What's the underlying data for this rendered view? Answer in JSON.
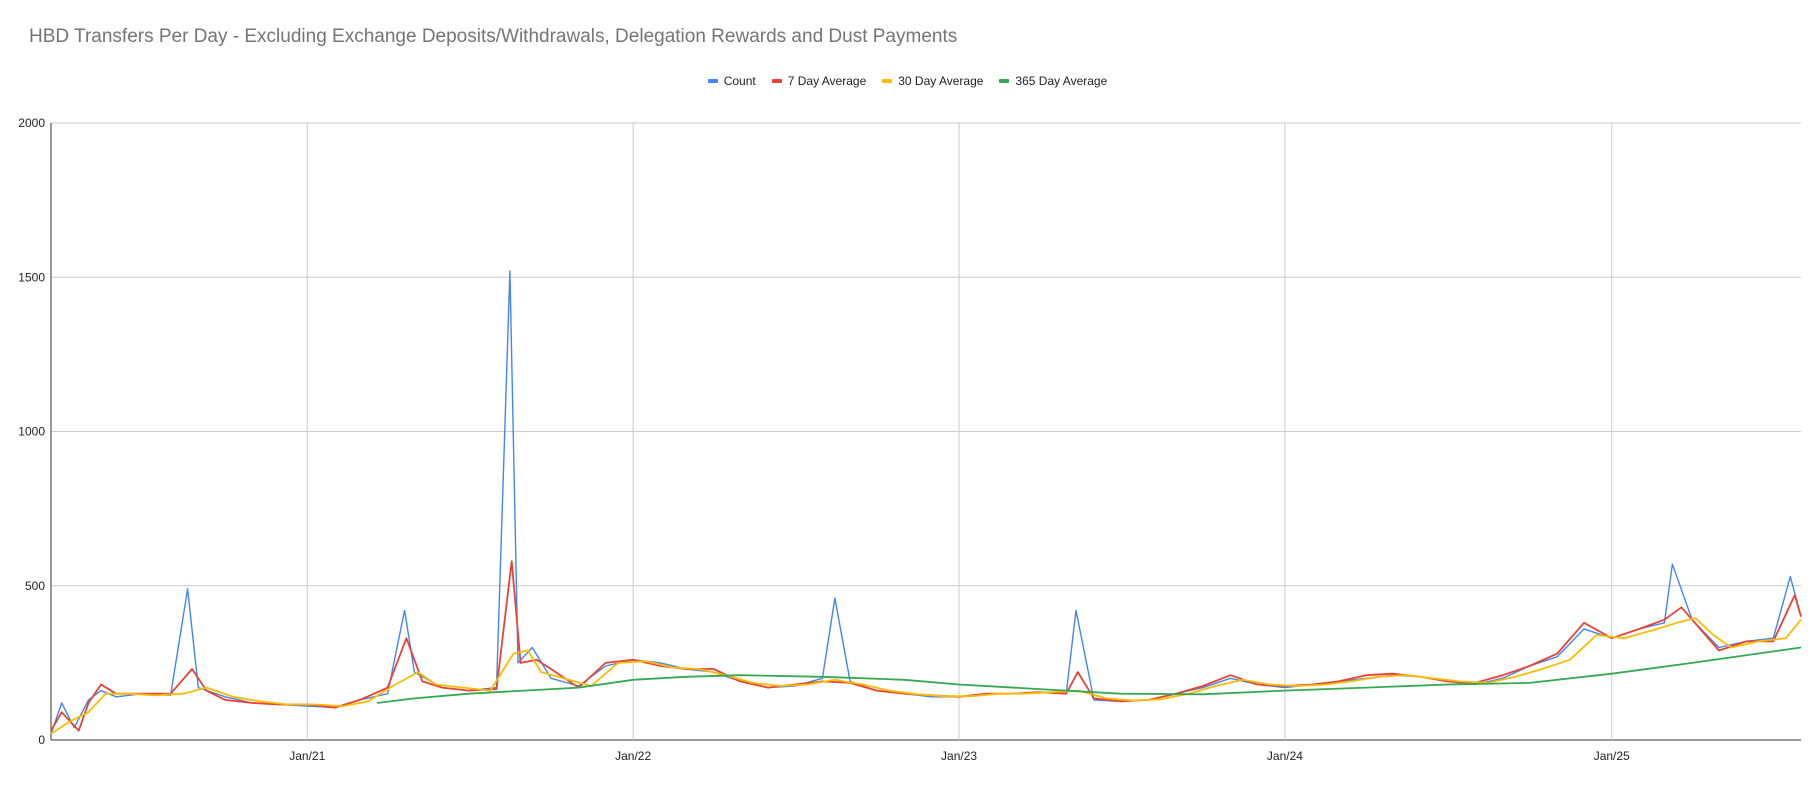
{
  "chart_data": {
    "type": "line",
    "title": "HBD Transfers Per Day - Excluding Exchange Deposits/Withdrawals, Delegation Rewards and Dust Payments",
    "xlabel": "",
    "ylabel": "",
    "x_range": [
      "2020-03-20",
      "2025-08-01"
    ],
    "ylim": [
      0,
      2000
    ],
    "y_ticks": [
      0,
      500,
      1000,
      1500,
      2000
    ],
    "x_ticks": [
      {
        "label": "Jan/21",
        "date": "2021-01-01"
      },
      {
        "label": "Jan/22",
        "date": "2022-01-01"
      },
      {
        "label": "Jan/23",
        "date": "2023-01-01"
      },
      {
        "label": "Jan/24",
        "date": "2024-01-01"
      },
      {
        "label": "Jan/25",
        "date": "2025-01-01"
      }
    ],
    "grid": true,
    "legend_position": "top-center",
    "series": [
      {
        "name": "Count",
        "color": "#4285f4",
        "note_sampled": true,
        "points": [
          [
            "2020-03-20",
            20
          ],
          [
            "2020-04-01",
            120
          ],
          [
            "2020-04-15",
            40
          ],
          [
            "2020-05-01",
            130
          ],
          [
            "2020-05-15",
            160
          ],
          [
            "2020-06-01",
            140
          ],
          [
            "2020-07-01",
            150
          ],
          [
            "2020-08-01",
            145
          ],
          [
            "2020-08-20",
            490
          ],
          [
            "2020-09-01",
            170
          ],
          [
            "2020-10-01",
            140
          ],
          [
            "2020-11-01",
            120
          ],
          [
            "2020-12-01",
            115
          ],
          [
            "2021-01-01",
            110
          ],
          [
            "2021-02-01",
            105
          ],
          [
            "2021-03-01",
            130
          ],
          [
            "2021-04-01",
            150
          ],
          [
            "2021-04-20",
            420
          ],
          [
            "2021-05-01",
            220
          ],
          [
            "2021-06-01",
            170
          ],
          [
            "2021-07-01",
            160
          ],
          [
            "2021-08-01",
            170
          ],
          [
            "2021-08-16",
            1520
          ],
          [
            "2021-08-25",
            250
          ],
          [
            "2021-09-10",
            300
          ],
          [
            "2021-10-01",
            200
          ],
          [
            "2021-11-01",
            175
          ],
          [
            "2021-12-01",
            240
          ],
          [
            "2022-01-01",
            260
          ],
          [
            "2022-02-01",
            250
          ],
          [
            "2022-03-01",
            230
          ],
          [
            "2022-04-01",
            220
          ],
          [
            "2022-05-01",
            190
          ],
          [
            "2022-06-01",
            170
          ],
          [
            "2022-07-01",
            175
          ],
          [
            "2022-08-01",
            200
          ],
          [
            "2022-08-15",
            460
          ],
          [
            "2022-09-01",
            190
          ],
          [
            "2022-10-01",
            160
          ],
          [
            "2022-11-01",
            150
          ],
          [
            "2022-12-01",
            140
          ],
          [
            "2023-01-01",
            140
          ],
          [
            "2023-02-01",
            150
          ],
          [
            "2023-03-01",
            150
          ],
          [
            "2023-04-01",
            155
          ],
          [
            "2023-05-01",
            150
          ],
          [
            "2023-05-12",
            420
          ],
          [
            "2023-06-01",
            130
          ],
          [
            "2023-07-01",
            125
          ],
          [
            "2023-08-01",
            130
          ],
          [
            "2023-09-01",
            150
          ],
          [
            "2023-10-01",
            170
          ],
          [
            "2023-11-01",
            200
          ],
          [
            "2023-12-01",
            180
          ],
          [
            "2024-01-01",
            170
          ],
          [
            "2024-02-01",
            180
          ],
          [
            "2024-03-01",
            190
          ],
          [
            "2024-04-01",
            200
          ],
          [
            "2024-05-01",
            210
          ],
          [
            "2024-06-01",
            205
          ],
          [
            "2024-07-01",
            190
          ],
          [
            "2024-08-01",
            180
          ],
          [
            "2024-09-01",
            200
          ],
          [
            "2024-10-01",
            240
          ],
          [
            "2024-11-01",
            270
          ],
          [
            "2024-12-01",
            360
          ],
          [
            "2025-01-01",
            330
          ],
          [
            "2025-02-01",
            360
          ],
          [
            "2025-03-01",
            380
          ],
          [
            "2025-03-10",
            570
          ],
          [
            "2025-04-01",
            390
          ],
          [
            "2025-05-01",
            300
          ],
          [
            "2025-06-01",
            320
          ],
          [
            "2025-07-01",
            330
          ],
          [
            "2025-07-20",
            530
          ],
          [
            "2025-08-01",
            400
          ]
        ]
      },
      {
        "name": "7 Day Average",
        "color": "#ea4335",
        "points": [
          [
            "2020-03-20",
            30
          ],
          [
            "2020-04-01",
            90
          ],
          [
            "2020-04-20",
            30
          ],
          [
            "2020-05-01",
            120
          ],
          [
            "2020-05-15",
            180
          ],
          [
            "2020-06-01",
            150
          ],
          [
            "2020-07-01",
            150
          ],
          [
            "2020-08-01",
            150
          ],
          [
            "2020-08-25",
            230
          ],
          [
            "2020-09-10",
            160
          ],
          [
            "2020-10-01",
            130
          ],
          [
            "2020-11-01",
            120
          ],
          [
            "2020-12-01",
            115
          ],
          [
            "2021-01-01",
            115
          ],
          [
            "2021-02-01",
            105
          ],
          [
            "2021-03-01",
            130
          ],
          [
            "2021-04-01",
            170
          ],
          [
            "2021-04-22",
            330
          ],
          [
            "2021-05-10",
            190
          ],
          [
            "2021-06-01",
            170
          ],
          [
            "2021-07-01",
            160
          ],
          [
            "2021-08-01",
            165
          ],
          [
            "2021-08-18",
            580
          ],
          [
            "2021-08-28",
            250
          ],
          [
            "2021-09-15",
            260
          ],
          [
            "2021-10-01",
            230
          ],
          [
            "2021-11-01",
            170
          ],
          [
            "2021-12-01",
            250
          ],
          [
            "2022-01-01",
            260
          ],
          [
            "2022-02-01",
            240
          ],
          [
            "2022-03-01",
            230
          ],
          [
            "2022-04-01",
            230
          ],
          [
            "2022-05-01",
            190
          ],
          [
            "2022-06-01",
            170
          ],
          [
            "2022-07-01",
            180
          ],
          [
            "2022-08-01",
            190
          ],
          [
            "2022-09-01",
            185
          ],
          [
            "2022-10-01",
            160
          ],
          [
            "2022-11-01",
            150
          ],
          [
            "2022-12-01",
            145
          ],
          [
            "2023-01-01",
            140
          ],
          [
            "2023-02-01",
            150
          ],
          [
            "2023-03-01",
            150
          ],
          [
            "2023-04-01",
            155
          ],
          [
            "2023-05-01",
            150
          ],
          [
            "2023-05-14",
            220
          ],
          [
            "2023-06-01",
            135
          ],
          [
            "2023-07-01",
            125
          ],
          [
            "2023-08-01",
            130
          ],
          [
            "2023-09-01",
            150
          ],
          [
            "2023-10-01",
            175
          ],
          [
            "2023-11-01",
            210
          ],
          [
            "2023-12-01",
            180
          ],
          [
            "2024-01-01",
            175
          ],
          [
            "2024-02-01",
            180
          ],
          [
            "2024-03-01",
            190
          ],
          [
            "2024-04-01",
            210
          ],
          [
            "2024-05-01",
            215
          ],
          [
            "2024-06-01",
            205
          ],
          [
            "2024-07-01",
            190
          ],
          [
            "2024-08-01",
            185
          ],
          [
            "2024-09-01",
            210
          ],
          [
            "2024-10-01",
            240
          ],
          [
            "2024-11-01",
            280
          ],
          [
            "2024-12-01",
            380
          ],
          [
            "2025-01-01",
            330
          ],
          [
            "2025-02-01",
            360
          ],
          [
            "2025-03-01",
            390
          ],
          [
            "2025-03-20",
            430
          ],
          [
            "2025-04-01",
            390
          ],
          [
            "2025-05-01",
            290
          ],
          [
            "2025-06-01",
            320
          ],
          [
            "2025-07-01",
            320
          ],
          [
            "2025-07-25",
            470
          ],
          [
            "2025-08-01",
            400
          ]
        ]
      },
      {
        "name": "30 Day Average",
        "color": "#fbbc04",
        "points": [
          [
            "2020-03-20",
            20
          ],
          [
            "2020-04-10",
            60
          ],
          [
            "2020-05-01",
            90
          ],
          [
            "2020-05-20",
            150
          ],
          [
            "2020-06-15",
            150
          ],
          [
            "2020-07-15",
            145
          ],
          [
            "2020-08-15",
            150
          ],
          [
            "2020-09-10",
            170
          ],
          [
            "2020-10-10",
            140
          ],
          [
            "2020-11-10",
            125
          ],
          [
            "2020-12-10",
            115
          ],
          [
            "2021-01-10",
            115
          ],
          [
            "2021-02-10",
            110
          ],
          [
            "2021-03-10",
            125
          ],
          [
            "2021-04-10",
            180
          ],
          [
            "2021-05-05",
            220
          ],
          [
            "2021-05-25",
            180
          ],
          [
            "2021-06-25",
            170
          ],
          [
            "2021-07-25",
            160
          ],
          [
            "2021-08-20",
            280
          ],
          [
            "2021-09-05",
            290
          ],
          [
            "2021-09-20",
            220
          ],
          [
            "2021-10-15",
            200
          ],
          [
            "2021-11-15",
            175
          ],
          [
            "2021-12-15",
            250
          ],
          [
            "2022-01-15",
            255
          ],
          [
            "2022-02-15",
            235
          ],
          [
            "2022-03-15",
            230
          ],
          [
            "2022-04-15",
            210
          ],
          [
            "2022-05-15",
            185
          ],
          [
            "2022-06-15",
            175
          ],
          [
            "2022-07-15",
            180
          ],
          [
            "2022-08-15",
            195
          ],
          [
            "2022-09-15",
            180
          ],
          [
            "2022-10-15",
            160
          ],
          [
            "2022-11-15",
            148
          ],
          [
            "2022-12-15",
            142
          ],
          [
            "2023-01-15",
            142
          ],
          [
            "2023-02-15",
            150
          ],
          [
            "2023-03-15",
            150
          ],
          [
            "2023-04-15",
            155
          ],
          [
            "2023-05-15",
            160
          ],
          [
            "2023-06-15",
            135
          ],
          [
            "2023-07-15",
            128
          ],
          [
            "2023-08-15",
            132
          ],
          [
            "2023-09-15",
            150
          ],
          [
            "2023-10-15",
            175
          ],
          [
            "2023-11-15",
            195
          ],
          [
            "2023-12-15",
            180
          ],
          [
            "2024-01-15",
            175
          ],
          [
            "2024-02-15",
            180
          ],
          [
            "2024-03-15",
            190
          ],
          [
            "2024-04-15",
            205
          ],
          [
            "2024-05-15",
            210
          ],
          [
            "2024-06-15",
            200
          ],
          [
            "2024-07-15",
            190
          ],
          [
            "2024-08-15",
            185
          ],
          [
            "2024-09-15",
            205
          ],
          [
            "2024-10-15",
            230
          ],
          [
            "2024-11-15",
            260
          ],
          [
            "2024-12-15",
            340
          ],
          [
            "2025-01-15",
            330
          ],
          [
            "2025-02-15",
            355
          ],
          [
            "2025-03-15",
            380
          ],
          [
            "2025-04-05",
            395
          ],
          [
            "2025-04-25",
            340
          ],
          [
            "2025-05-15",
            300
          ],
          [
            "2025-06-15",
            320
          ],
          [
            "2025-07-15",
            330
          ],
          [
            "2025-08-01",
            390
          ]
        ]
      },
      {
        "name": "365 Day Average",
        "color": "#34a853",
        "points": [
          [
            "2021-03-20",
            120
          ],
          [
            "2021-05-01",
            135
          ],
          [
            "2021-07-01",
            150
          ],
          [
            "2021-09-01",
            160
          ],
          [
            "2021-11-01",
            170
          ],
          [
            "2022-01-01",
            195
          ],
          [
            "2022-03-01",
            205
          ],
          [
            "2022-05-01",
            210
          ],
          [
            "2022-08-01",
            205
          ],
          [
            "2022-11-01",
            195
          ],
          [
            "2023-01-01",
            180
          ],
          [
            "2023-04-01",
            165
          ],
          [
            "2023-07-01",
            150
          ],
          [
            "2023-10-01",
            148
          ],
          [
            "2024-01-01",
            160
          ],
          [
            "2024-04-01",
            170
          ],
          [
            "2024-07-01",
            180
          ],
          [
            "2024-10-01",
            185
          ],
          [
            "2025-01-01",
            215
          ],
          [
            "2025-04-01",
            250
          ],
          [
            "2025-08-01",
            300
          ]
        ]
      }
    ]
  }
}
